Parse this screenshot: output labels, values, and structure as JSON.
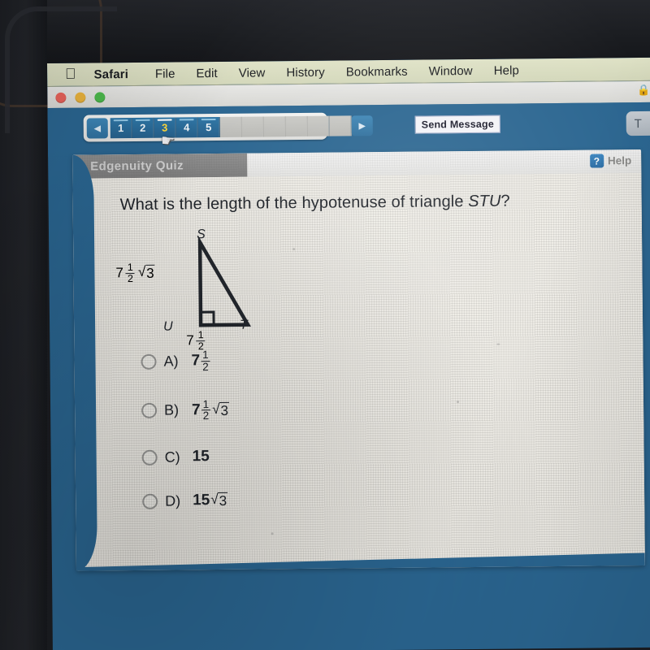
{
  "menubar": {
    "apple_icon": "apple-logo",
    "items": [
      {
        "label": "Safari",
        "bold": true
      },
      {
        "label": "File"
      },
      {
        "label": "Edit"
      },
      {
        "label": "View"
      },
      {
        "label": "History"
      },
      {
        "label": "Bookmarks"
      },
      {
        "label": "Window"
      },
      {
        "label": "Help"
      }
    ]
  },
  "window": {
    "traffic_lights": [
      "close-red",
      "minimize-yellow",
      "zoom-green"
    ],
    "lock_icon": "lock-icon"
  },
  "appbar": {
    "prev_arrow": "◀",
    "next_arrow": "▶",
    "pages": [
      "1",
      "2",
      "3",
      "4",
      "5"
    ],
    "current_page": "3",
    "empty_slots": 9,
    "send_message_label": "Send Message",
    "tools_label": "T",
    "cursor": "pointing-hand-cursor"
  },
  "panel": {
    "quiz_title": "Edgenuity Quiz",
    "help_badge": "?",
    "help_label": "Help"
  },
  "question": {
    "text_before": "What is the length of the hypotenuse of triangle ",
    "italic_part": "STU",
    "text_after": "?"
  },
  "figure": {
    "vertices": {
      "top": "S",
      "bottom_left": "U",
      "bottom_right": "T"
    },
    "right_angle_at": "U",
    "leg_left": {
      "whole": "7",
      "num": "1",
      "den": "2",
      "radical": "3"
    },
    "leg_bottom": {
      "whole": "7",
      "num": "1",
      "den": "2"
    }
  },
  "options": [
    {
      "letter": "A)",
      "whole": "7",
      "num": "1",
      "den": "2",
      "radical": "",
      "plain": "",
      "selected": false
    },
    {
      "letter": "B)",
      "whole": "7",
      "num": "1",
      "den": "2",
      "radical": "3",
      "plain": "",
      "selected": false
    },
    {
      "letter": "C)",
      "whole": "",
      "num": "",
      "den": "",
      "radical": "",
      "plain": "15",
      "selected": false
    },
    {
      "letter": "D)",
      "whole": "15",
      "num": "",
      "den": "",
      "radical": "3",
      "plain": "",
      "selected": false
    }
  ],
  "colors": {
    "app_blue": "#2a6590",
    "panel_bg": "#eeece6",
    "menubar": "#d8dcc0",
    "current_page_text": "#ffd83b",
    "quiz_header_gray": "#828282"
  }
}
